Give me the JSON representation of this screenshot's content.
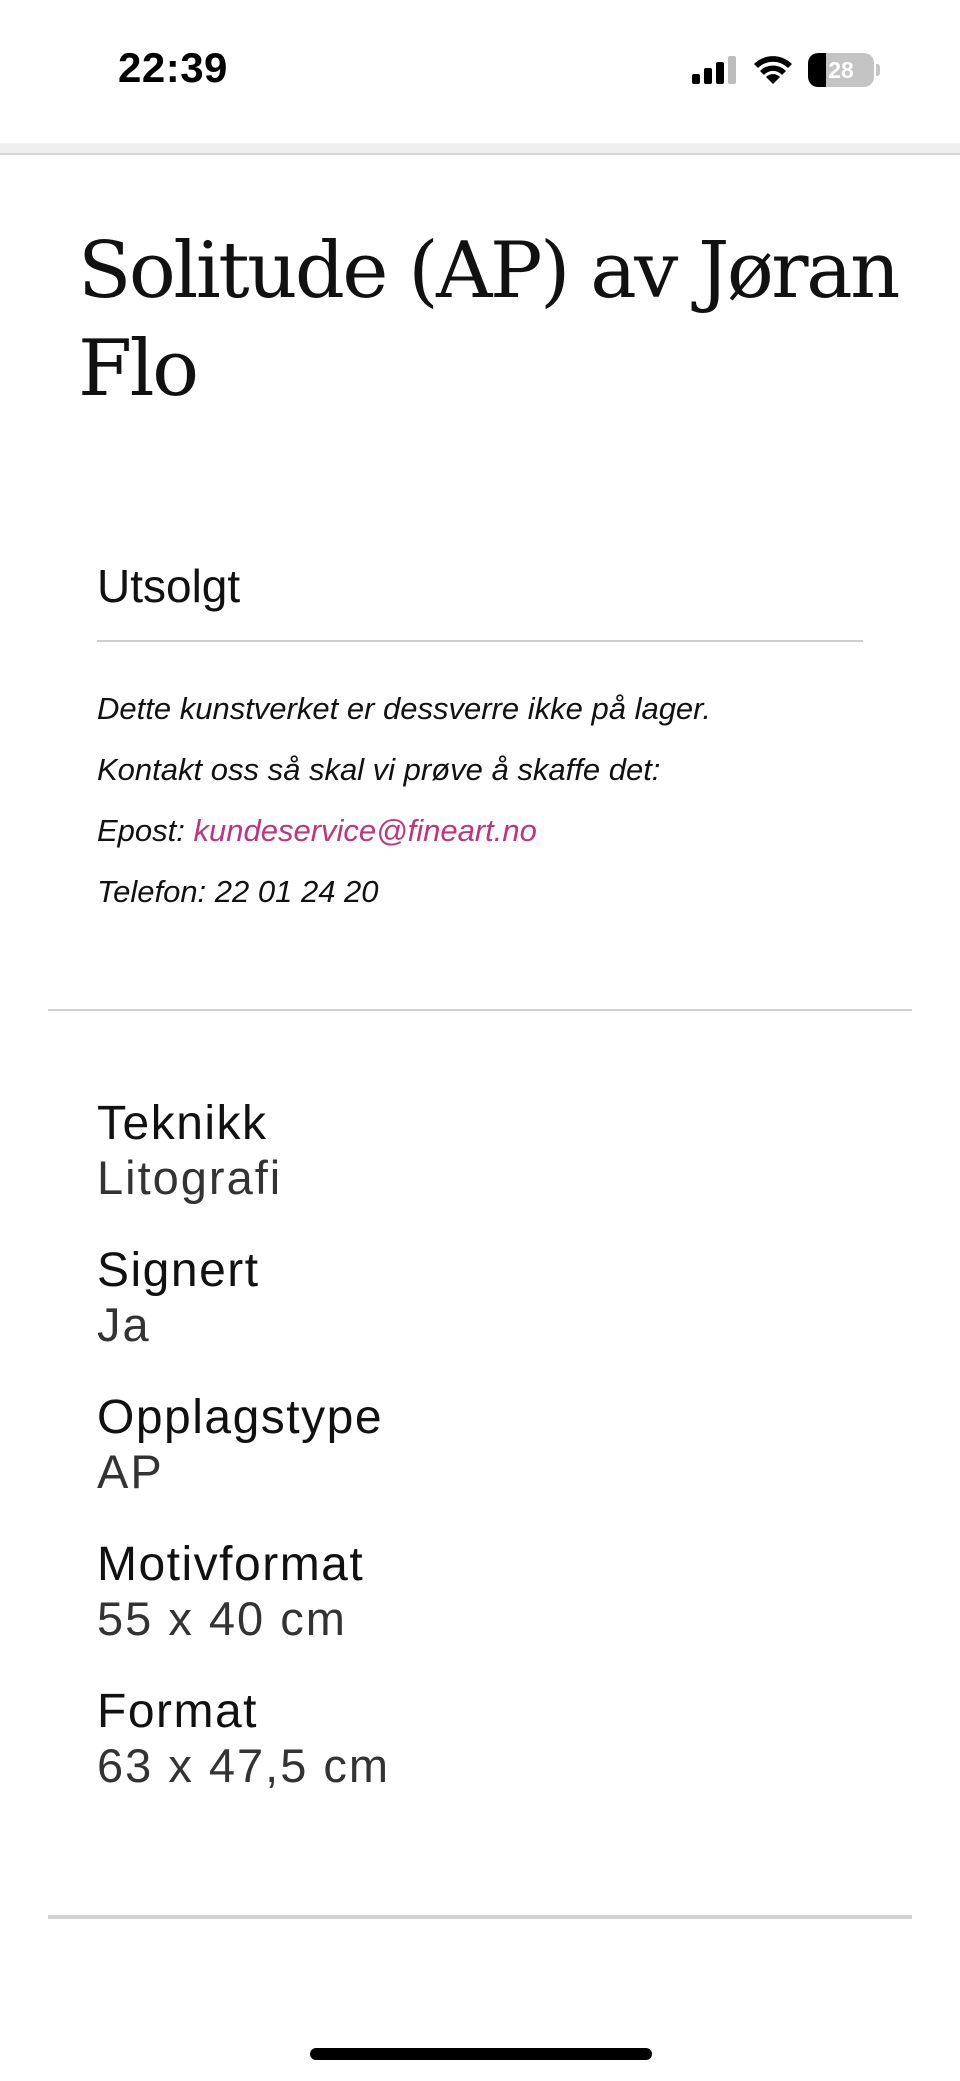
{
  "status_bar": {
    "time": "22:39",
    "signal_icon": "cellular-signal-icon",
    "wifi_icon": "wifi-icon",
    "battery_level": "28",
    "battery_fraction": 0.28
  },
  "product": {
    "title": "Solitude (AP) av Jøran Flo"
  },
  "stock": {
    "heading": "Utsolgt",
    "line1": "Dette kunstverket er dessverre ikke på lager.",
    "line2": "Kontakt oss så skal vi prøve å skaffe det:",
    "email_label": "Epost: ",
    "email": "kundeservice@fineart.no",
    "phone": "Telefon: 22 01 24 20"
  },
  "specs": [
    {
      "label": "Teknikk",
      "value": "Litografi"
    },
    {
      "label": "Signert",
      "value": "Ja"
    },
    {
      "label": "Opplagstype",
      "value": "AP"
    },
    {
      "label": "Motivformat",
      "value": "55 x 40 cm"
    },
    {
      "label": "Format",
      "value": "63 x 47,5 cm"
    }
  ],
  "colors": {
    "link": "#c2327e",
    "divider": "#d0d0d0",
    "text": "#111111"
  }
}
